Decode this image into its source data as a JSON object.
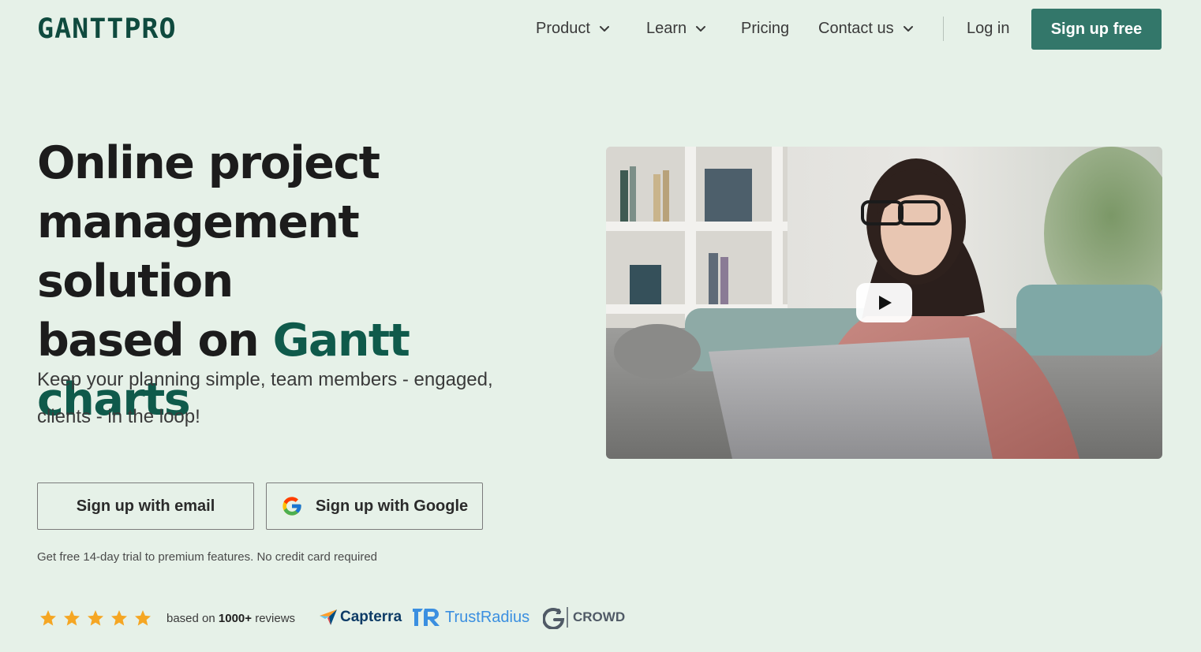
{
  "header": {
    "logo": "GANTTPRO",
    "nav": [
      {
        "label": "Product",
        "has_dropdown": true
      },
      {
        "label": "Learn",
        "has_dropdown": true
      },
      {
        "label": "Pricing",
        "has_dropdown": false
      },
      {
        "label": "Contact us",
        "has_dropdown": true
      }
    ],
    "login_label": "Log in",
    "signup_label": "Sign up free"
  },
  "hero": {
    "title_line1": "Online project",
    "title_line2": "management solution",
    "title_line3_prefix": "based on ",
    "title_highlight": "Gantt charts",
    "subtitle_line1": "Keep your planning simple, team members - engaged,",
    "subtitle_line2": "clients - in the loop!",
    "signup_email_label": "Sign up with email",
    "signup_google_label": "Sign up with Google",
    "trial_note": "Get free 14-day trial to premium features. No credit card required"
  },
  "reviews": {
    "stars": 5,
    "text_prefix": "based on ",
    "count": "1000+",
    "text_suffix": " reviews",
    "platforms": [
      {
        "name": "Capterra"
      },
      {
        "name": "TrustRadius"
      },
      {
        "name": "CROWD"
      }
    ]
  },
  "video": {
    "play_icon": "play-icon"
  },
  "colors": {
    "background": "#e6f1e8",
    "brand": "#0f4a3e",
    "highlight": "#0f5a4b",
    "primary_button": "#33776a",
    "star": "#f5a623"
  }
}
